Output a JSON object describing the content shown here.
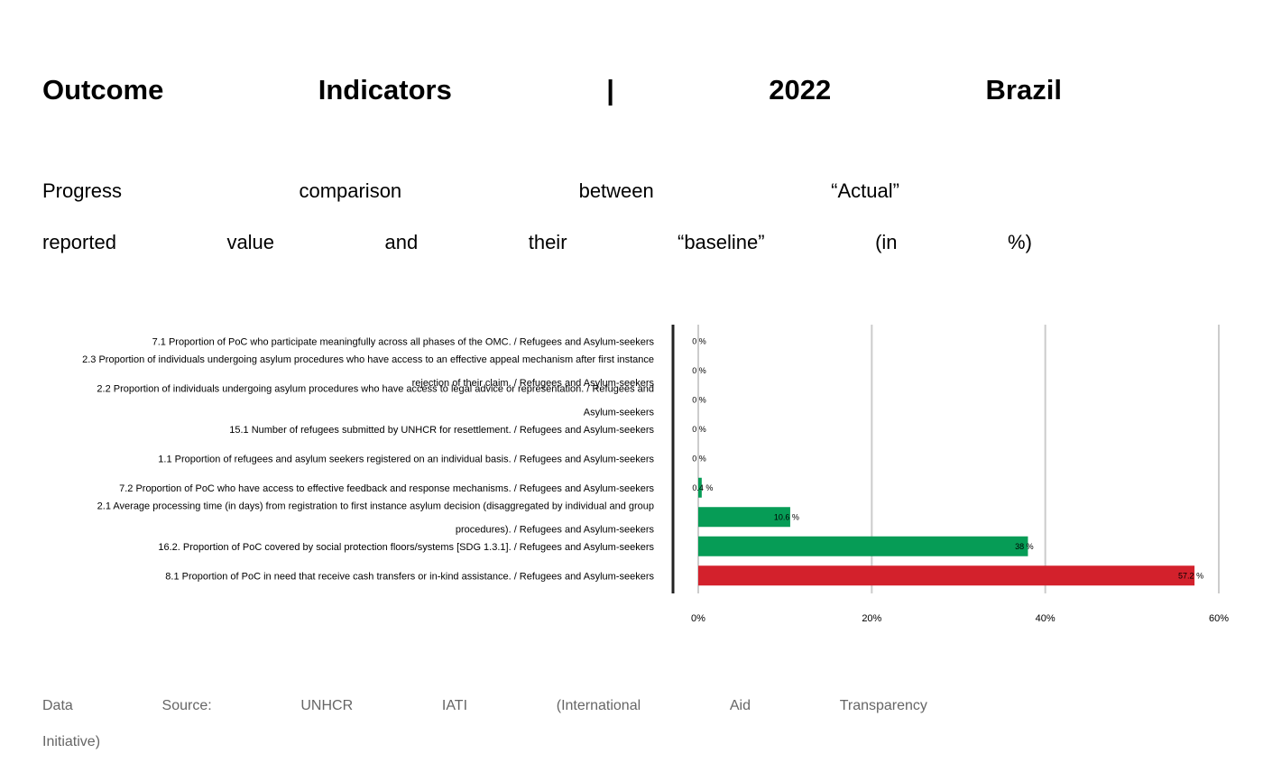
{
  "title": {
    "w1": "Outcome",
    "w2": "Indicators",
    "sep": "|",
    "year": "2022",
    "country": "Brazil"
  },
  "subtitle": {
    "line1": [
      "Progress",
      "comparison",
      "between",
      "“Actual”"
    ],
    "line2": [
      "reported",
      "value",
      "and",
      "their",
      "“baseline”",
      "(in",
      "%)"
    ]
  },
  "source": {
    "line1": [
      "Data",
      "Source:",
      "UNHCR",
      "IATI",
      "(International",
      "Aid",
      "Transparency"
    ],
    "line2": "Initiative)"
  },
  "colors": {
    "green": "#069c56",
    "red": "#d3212c",
    "grid": "#cccccc",
    "axis": "#222222"
  },
  "chart_data": {
    "type": "bar",
    "orientation": "horizontal",
    "xlim": [
      0,
      60
    ],
    "xticks": [
      "0%",
      "20%",
      "40%",
      "60%"
    ],
    "xtick_values": [
      0,
      20,
      40,
      60
    ],
    "grid": true,
    "categories": [
      "7.1 Proportion of PoC who participate meaningfully across all phases of the OMC. / Refugees and Asylum-seekers",
      "2.3 Proportion of individuals undergoing asylum procedures who have access to an effective appeal mechanism after first instance rejection of their claim. / Refugees and Asylum-seekers",
      "2.2 Proportion of individuals undergoing asylum procedures who have access to legal advice or representation. / Refugees and Asylum-seekers",
      "15.1 Number of refugees submitted by UNHCR for resettlement. / Refugees and Asylum-seekers",
      "1.1 Proportion of refugees and asylum seekers registered on an individual basis. / Refugees and Asylum-seekers",
      "7.2 Proportion of PoC who have access to effective feedback and response mechanisms. / Refugees and Asylum-seekers",
      "2.1 Average processing time (in days) from registration to first instance asylum decision (disaggregated by individual and group procedures). / Refugees and Asylum-seekers",
      "16.2. Proportion of PoC covered by social protection floors/systems [SDG 1.3.1]. / Refugees and Asylum-seekers",
      "8.1 Proportion of PoC in need that receive cash transfers or in-kind assistance. / Refugees and Asylum-seekers"
    ],
    "values": [
      0,
      0,
      0,
      0,
      0,
      0.4,
      10.6,
      38,
      57.2
    ],
    "value_labels": [
      "0 %",
      "0 %",
      "0 %",
      "0 %",
      "0 %",
      "0.4 %",
      "10.6 %",
      "38 %",
      "57.2 %"
    ],
    "bar_colors": [
      "green",
      "green",
      "green",
      "green",
      "green",
      "green",
      "green",
      "green",
      "red"
    ]
  }
}
